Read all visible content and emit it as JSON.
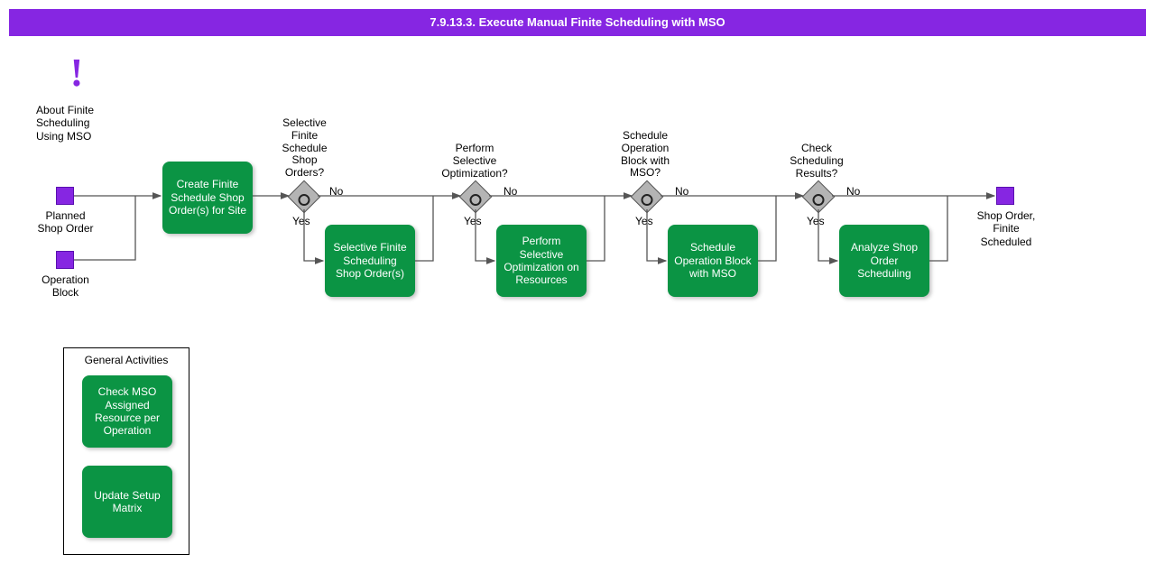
{
  "title": "7.9.13.3. Execute Manual Finite Scheduling with MSO",
  "info": {
    "label": "About Finite\nScheduling\nUsing MSO"
  },
  "inputs": {
    "planned": "Planned\nShop Order",
    "opblock": "Operation\nBlock"
  },
  "activities": {
    "create": "Create Finite Schedule Shop Order(s) for Site",
    "selective": "Selective Finite Scheduling Shop Order(s)",
    "perform": "Perform Selective Optimization on Resources",
    "schedule": "Schedule Operation Block with MSO",
    "analyze": "Analyze Shop Order Scheduling"
  },
  "gateways": {
    "g1": "Selective\nFinite\nSchedule\nShop\nOrders?",
    "g2": "Perform\nSelective\nOptimization?",
    "g3": "Schedule\nOperation\nBlock with\nMSO?",
    "g4": "Check\nScheduling\nResults?"
  },
  "labels": {
    "yes": "Yes",
    "no": "No"
  },
  "output": "Shop Order,\nFinite\nScheduled",
  "general": {
    "title": "General Activities",
    "check": "Check MSO Assigned Resource per Operation",
    "update": "Update Setup Matrix"
  }
}
